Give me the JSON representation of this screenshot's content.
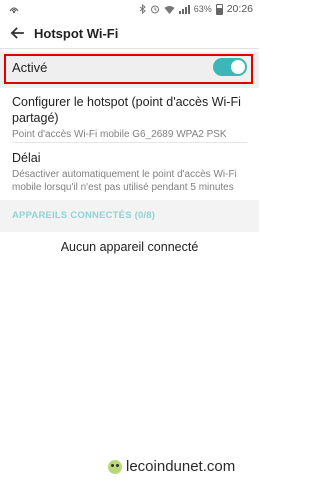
{
  "status_bar": {
    "left_icon": "wifi-hotspot-icon",
    "icons": [
      "bluetooth-icon",
      "alarm-icon",
      "wifi-icon",
      "signal-icon",
      "battery-icon"
    ],
    "battery": "63%",
    "time": "20:26"
  },
  "app_bar": {
    "title": "Hotspot Wi-Fi",
    "back_icon": "arrow-back-icon"
  },
  "toggle": {
    "label": "Activé",
    "state": "on",
    "accent_color": "#3cb7b7",
    "highlight_color": "#e00000"
  },
  "settings": [
    {
      "title": "Configurer le hotspot (point d'accès Wi-Fi partagé)",
      "subtitle": "Point d'accès Wi-Fi mobile G6_2689 WPA2 PSK"
    },
    {
      "title": "Délai",
      "subtitle": "Désactiver automatiquement le point d'accès Wi-Fi mobile lorsqu'il n'est pas utilisé pendant 5 minutes"
    }
  ],
  "connected_section": {
    "header": "APPAREILS CONNECTÉS (0/8)",
    "empty_message": "Aucun appareil connecté"
  },
  "watermark": {
    "text": "lecoindunet.com"
  }
}
